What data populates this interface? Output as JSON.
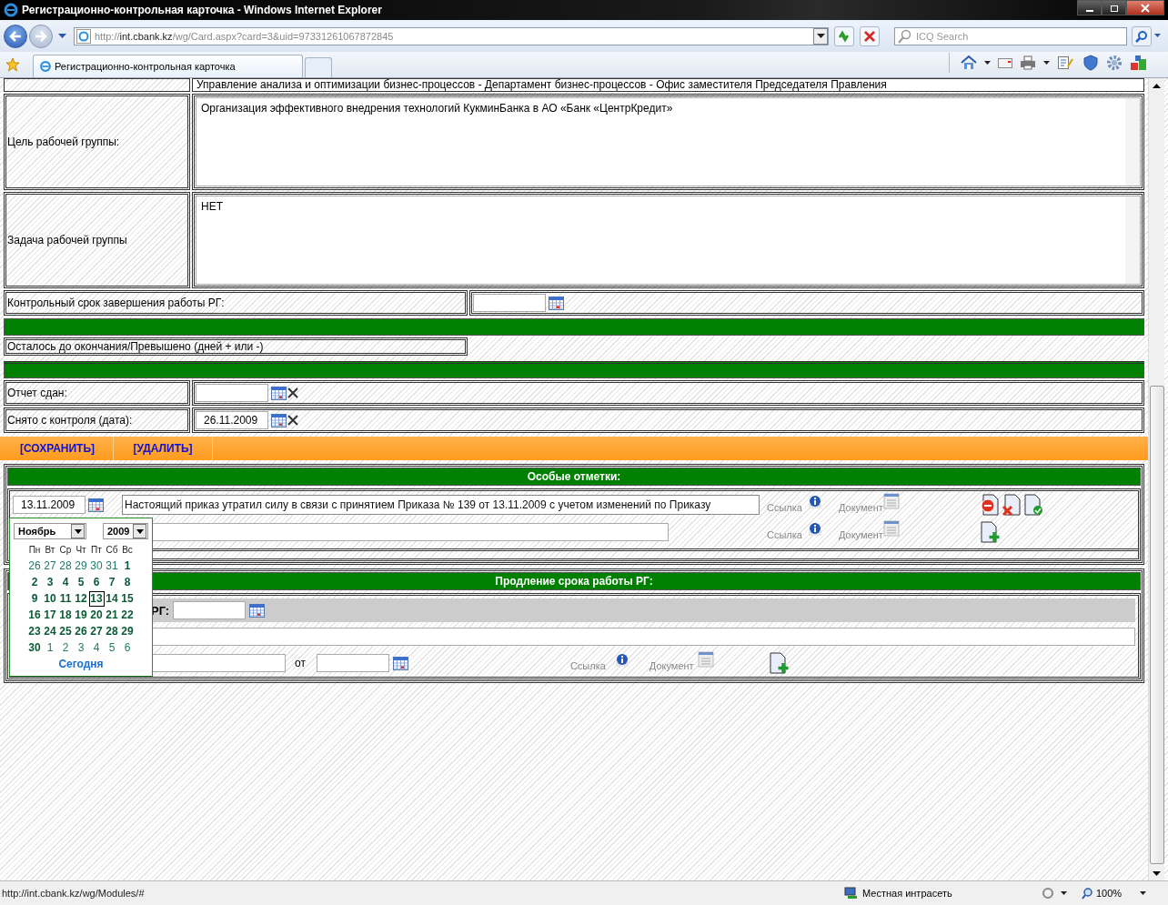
{
  "window": {
    "title": "Регистрационно-контрольная карточка - Windows Internet Explorer"
  },
  "address": {
    "scheme": "http://",
    "host": "int.cbank.kz",
    "path": "/wg/Card.aspx?card=3&uid=97331261067872845"
  },
  "search": {
    "placeholder": "ICQ Search"
  },
  "tab": {
    "label": "Регистрационно-контрольная карточка"
  },
  "form": {
    "cut_row": "Управление анализа и оптимизации бизнес-процессов - Департамент бизнес-процессов - Офис заместителя Председателя Правления",
    "goal": {
      "label": "Цель рабочей группы:",
      "value": "Организация эффективного внедрения технологий КукминБанка в АО «Банк «ЦентрКредит»"
    },
    "task": {
      "label": "Задача рабочей группы",
      "value": "НЕТ"
    },
    "deadline": {
      "label": "Контрольный срок завершения работы РГ:"
    },
    "remaining": {
      "label": "Осталось до окончания/Превышено (дней + или -)"
    },
    "report": {
      "label": "Отчет сдан:"
    },
    "removed": {
      "label": "Снято с контроля (дата):",
      "value": "26.11.2009"
    },
    "actions": [
      "[СОХРАНИТЬ]",
      "[УДАЛИТЬ]"
    ]
  },
  "notes": {
    "title": "Особые отметки:",
    "rows": [
      {
        "date": "13.11.2009",
        "text": "Настоящий приказ утратил силу в связи с принятием Приказа № 139 от 13.11.2009 с учетом изменений по Приказу",
        "link": "Ссылка",
        "document": "Документ",
        "tools": [
          {
            "kind": "stop"
          },
          {
            "kind": "delete"
          },
          {
            "kind": "approve"
          }
        ]
      },
      {
        "link": "Ссылка",
        "document": "Документ",
        "tools": [
          {
            "kind": "add"
          }
        ]
      }
    ]
  },
  "extension": {
    "title": "Продление срока работы РГ:",
    "label": "РГ:",
    "from": "от",
    "link": "Ссылка",
    "document": "Документ"
  },
  "calendar": {
    "month": "Ноябрь",
    "year": "2009",
    "weekdays": [
      "Пн",
      "Вт",
      "Ср",
      "Чт",
      "Пт",
      "Сб",
      "Вс"
    ],
    "weeks": [
      [
        {
          "day": "26",
          "other": true,
          "selected": false
        },
        {
          "day": "27",
          "other": true,
          "selected": false
        },
        {
          "day": "28",
          "other": true,
          "selected": false
        },
        {
          "day": "29",
          "other": true,
          "selected": false
        },
        {
          "day": "30",
          "other": true,
          "selected": false
        },
        {
          "day": "31",
          "other": true,
          "selected": false
        },
        {
          "day": "1",
          "other": false,
          "selected": false
        }
      ],
      [
        {
          "day": "2",
          "other": false,
          "selected": false
        },
        {
          "day": "3",
          "other": false,
          "selected": false
        },
        {
          "day": "4",
          "other": false,
          "selected": false
        },
        {
          "day": "5",
          "other": false,
          "selected": false
        },
        {
          "day": "6",
          "other": false,
          "selected": false
        },
        {
          "day": "7",
          "other": false,
          "selected": false
        },
        {
          "day": "8",
          "other": false,
          "selected": false
        }
      ],
      [
        {
          "day": "9",
          "other": false,
          "selected": false
        },
        {
          "day": "10",
          "other": false,
          "selected": false
        },
        {
          "day": "11",
          "other": false,
          "selected": false
        },
        {
          "day": "12",
          "other": false,
          "selected": false
        },
        {
          "day": "13",
          "other": false,
          "selected": true
        },
        {
          "day": "14",
          "other": false,
          "selected": false
        },
        {
          "day": "15",
          "other": false,
          "selected": false
        }
      ],
      [
        {
          "day": "16",
          "other": false,
          "selected": false
        },
        {
          "day": "17",
          "other": false,
          "selected": false
        },
        {
          "day": "18",
          "other": false,
          "selected": false
        },
        {
          "day": "19",
          "other": false,
          "selected": false
        },
        {
          "day": "20",
          "other": false,
          "selected": false
        },
        {
          "day": "21",
          "other": false,
          "selected": false
        },
        {
          "day": "22",
          "other": false,
          "selected": false
        }
      ],
      [
        {
          "day": "23",
          "other": false,
          "selected": false
        },
        {
          "day": "24",
          "other": false,
          "selected": false
        },
        {
          "day": "25",
          "other": false,
          "selected": false
        },
        {
          "day": "26",
          "other": false,
          "selected": false
        },
        {
          "day": "27",
          "other": false,
          "selected": false
        },
        {
          "day": "28",
          "other": false,
          "selected": false
        },
        {
          "day": "29",
          "other": false,
          "selected": false
        }
      ],
      [
        {
          "day": "30",
          "other": false,
          "selected": false
        },
        {
          "day": "1",
          "other": true,
          "selected": false
        },
        {
          "day": "2",
          "other": true,
          "selected": false
        },
        {
          "day": "3",
          "other": true,
          "selected": false
        },
        {
          "day": "4",
          "other": true,
          "selected": false
        },
        {
          "day": "5",
          "other": true,
          "selected": false
        },
        {
          "day": "6",
          "other": true,
          "selected": false
        }
      ]
    ],
    "today": "Сегодня"
  },
  "status_bar": {
    "url": "http://int.cbank.kz/wg/Modules/#",
    "zone": "Местная интрасеть",
    "zoom": "100%"
  }
}
